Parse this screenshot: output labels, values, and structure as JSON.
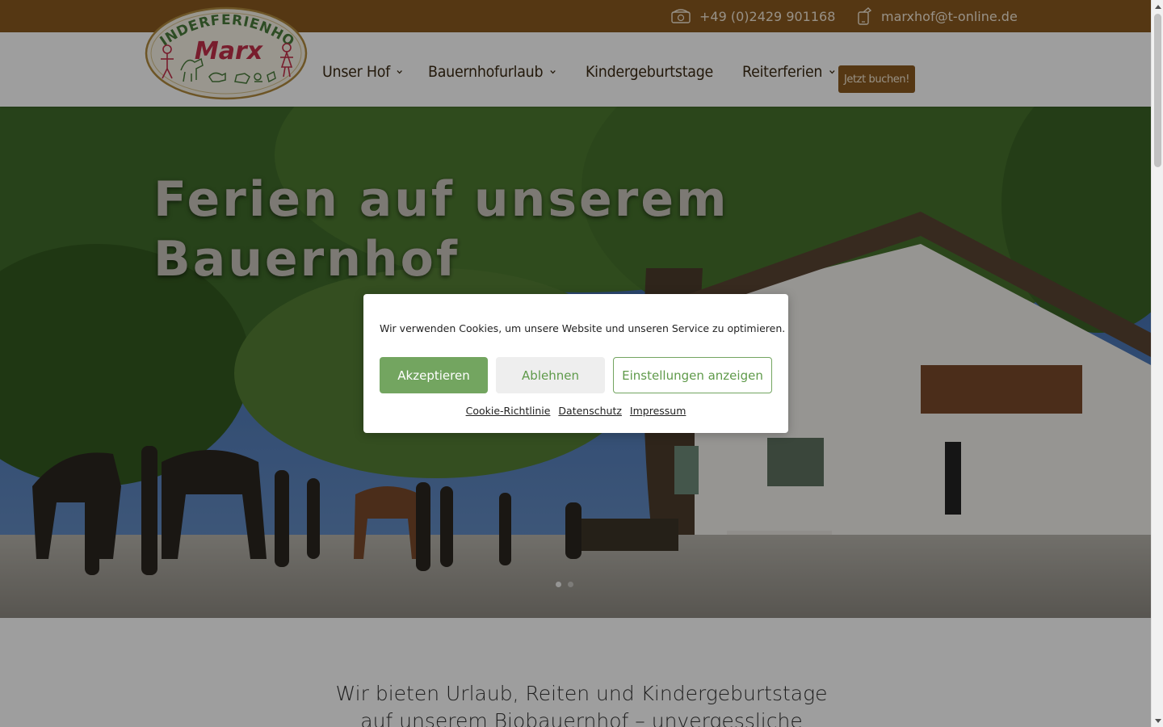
{
  "topbar": {
    "phone": "+49 (0)2429 901168",
    "email": "marxhof@t-online.de",
    "phone_icon": "phone-icon",
    "email_icon": "mobile-phone-icon"
  },
  "header": {
    "logo_top_text": "KINDERFERIENHOF",
    "logo_bottom_text": "Marx",
    "nav": [
      {
        "label": "Unser Hof",
        "has_dropdown": true
      },
      {
        "label": "Bauernhofurlaub",
        "has_dropdown": true
      },
      {
        "label": "Kindergeburtstage",
        "has_dropdown": false
      },
      {
        "label": "Reiterferien",
        "has_dropdown": true
      }
    ],
    "book_button": "Jetzt buchen!"
  },
  "hero": {
    "title": "Ferien auf unserem Bauernhof"
  },
  "intro": {
    "line1": "Wir bieten Urlaub, Reiten und Kindergeburtstage",
    "line2": "auf unserem Biobauernhof – unvergessliche"
  },
  "cookie": {
    "message": "Wir verwenden Cookies, um unsere Website und unseren Service zu optimieren.",
    "accept": "Akzeptieren",
    "deny": "Ablehnen",
    "settings": "Einstellungen anzeigen",
    "links": [
      "Cookie-Richtlinie",
      "Datenschutz",
      "Impressum"
    ]
  },
  "colors": {
    "brand_brown": "#8a5a1f",
    "accept_green": "#73a560",
    "nav_text": "#3b2a14"
  }
}
